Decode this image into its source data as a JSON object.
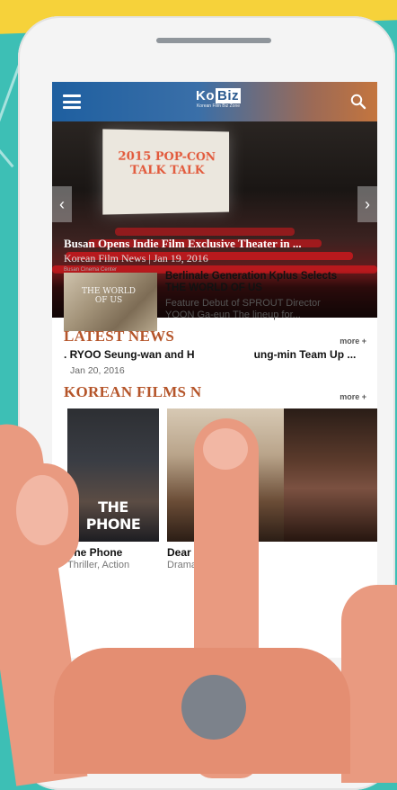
{
  "app": {
    "logo_text": "Ko",
    "logo_box_text": "Biz",
    "logo_subtitle": "Korean Film Biz Zone"
  },
  "hero": {
    "screen_text": "2015 POP-CON\nTALK TALK",
    "title": "Busan Opens Indie Film Exclusive Theater in ...",
    "meta": "Korean Film News | Jan 19, 2016",
    "credit": "Busan Cinema Center"
  },
  "latest_news": {
    "section_title": "LATEST NEWS",
    "more_label": "more +",
    "thumb_text": "THE WORLD OF US",
    "item1": {
      "headline": "Berlinale Generation Kplus Selects THE WORLD OF US",
      "summary": "Feature Debut of SPROUT Director YOON Ga-eun The lineup for..."
    },
    "item2": {
      "title": ". RYOO Seung-wan and H",
      "title_tail": "ung-min Team Up ...",
      "date": "Jan 20, 2016"
    }
  },
  "korean_films": {
    "section_title": "KOREAN FILMS N",
    "more_label": "more +",
    "films": [
      {
        "name": "The Phone",
        "genre": "Thriller, Action",
        "poster_text": "THE PHONE"
      },
      {
        "name": "Dear Dictator",
        "genre": "Drama"
      }
    ]
  },
  "colors": {
    "accent": "#b5552a",
    "header_start": "#1e5fa0",
    "header_end": "#c4753e",
    "background": "#3dbfb5"
  },
  "icons": [
    "menu-icon",
    "search-icon",
    "chevron-left-icon",
    "chevron-right-icon"
  ]
}
